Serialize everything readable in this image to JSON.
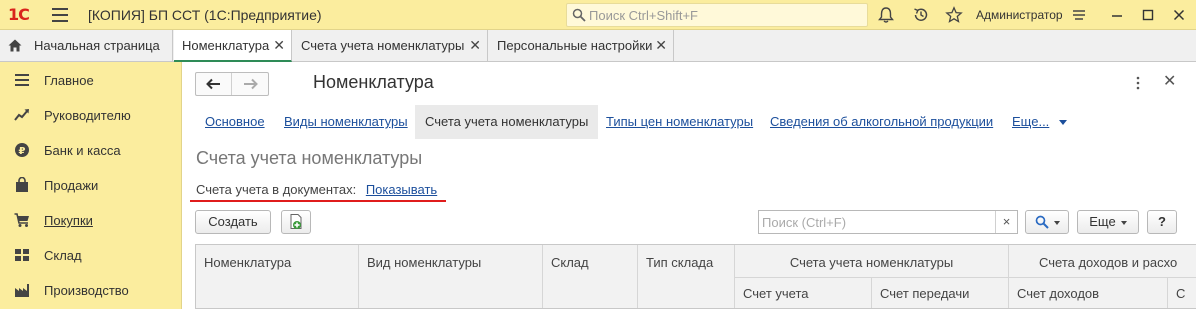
{
  "titlebar": {
    "logo": "1С",
    "title": "[КОПИЯ] БП ССТ  (1С:Предприятие)",
    "search_placeholder": "Поиск Ctrl+Shift+F",
    "user": "Администратор"
  },
  "tabs": [
    {
      "label": "Начальная страница",
      "closable": false,
      "active": false
    },
    {
      "label": "Номенклатура",
      "closable": true,
      "active": true
    },
    {
      "label": "Счета учета номенклатуры",
      "closable": true,
      "active": false
    },
    {
      "label": "Персональные настройки",
      "closable": true,
      "active": false
    }
  ],
  "sidebar": {
    "items": [
      {
        "label": "Главное",
        "icon": "menu-lines-icon"
      },
      {
        "label": "Руководителю",
        "icon": "trend-chart-icon"
      },
      {
        "label": "Банк и касса",
        "icon": "coin-icon"
      },
      {
        "label": "Продажи",
        "icon": "bag-icon"
      },
      {
        "label": "Покупки",
        "icon": "cart-icon"
      },
      {
        "label": "Склад",
        "icon": "warehouse-icon"
      },
      {
        "label": "Производство",
        "icon": "factory-icon"
      }
    ]
  },
  "form": {
    "title": "Номенклатура",
    "links": [
      {
        "label": "Основное",
        "active": false
      },
      {
        "label": "Виды номенклатуры",
        "active": false
      },
      {
        "label": "Счета учета номенклатуры",
        "active": true
      },
      {
        "label": "Типы цен номенклатуры",
        "active": false
      },
      {
        "label": "Сведения об алкогольной продукции",
        "active": false
      },
      {
        "label": "Еще...",
        "active": false
      }
    ],
    "section_title": "Счета учета номенклатуры",
    "accounts_label": "Счета учета в документах:",
    "accounts_link": "Показывать",
    "create_button": "Создать",
    "search_placeholder": "Поиск (Ctrl+F)",
    "clear_label": "×",
    "more_button": "Еще",
    "help_button": "?"
  },
  "table": {
    "columns": [
      "Номенклатура",
      "Вид номенклатуры",
      "Склад",
      "Тип склада"
    ],
    "group1": {
      "label": "Счета учета номенклатуры",
      "subcolumns": [
        "Счет учета",
        "Счет передачи"
      ]
    },
    "group2": {
      "label": "Счета доходов и расхо",
      "subcolumns": [
        "Счет доходов",
        "С"
      ]
    }
  },
  "colors": {
    "accent_yellow": "#fbed9e",
    "link_blue": "#1c4f9c",
    "active_tab_green": "#2e8b57",
    "red_underline": "#e01c1c"
  }
}
